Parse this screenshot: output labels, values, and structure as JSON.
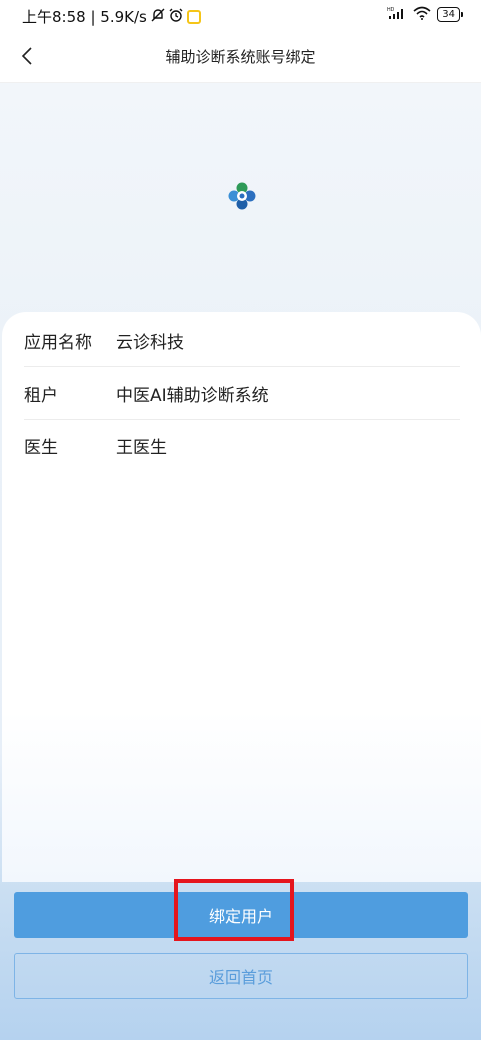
{
  "status_bar": {
    "time_net": "上午8:58 | 5.9K/s",
    "battery": "34",
    "signal_label": "HD"
  },
  "nav": {
    "title": "辅助诊断系统账号绑定"
  },
  "info": {
    "rows": [
      {
        "label": "应用名称",
        "value": "云诊科技"
      },
      {
        "label": "租户",
        "value": "中医AI辅助诊断系统"
      },
      {
        "label": "医生",
        "value": "王医生"
      }
    ]
  },
  "actions": {
    "bind_label": "绑定用户",
    "home_label": "返回首页"
  },
  "colors": {
    "primary": "#4f9ddf",
    "highlight": "#e5151d"
  }
}
